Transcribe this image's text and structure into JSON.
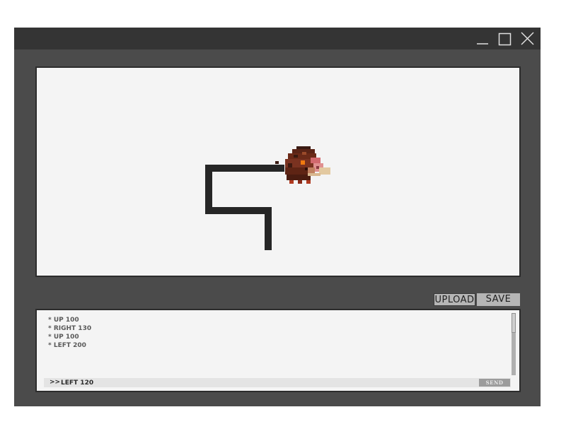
{
  "window": {
    "buttons": [
      {
        "name": "minimize",
        "icon": "minimize-icon"
      },
      {
        "name": "maximize",
        "icon": "maximize-icon"
      },
      {
        "name": "close",
        "icon": "close-icon"
      }
    ]
  },
  "canvas": {
    "sprite": "boar-pixel-sprite-icon"
  },
  "toolbar": {
    "upload_label": "UPLOAD",
    "save_label": "SAVE"
  },
  "console": {
    "history": [
      "* UP 100",
      "* RIGHT 130",
      "* UP 100",
      "* LEFT 200"
    ],
    "prompt_prefix": ">>",
    "input_value": "LEFT 120",
    "send_label": "SEND"
  },
  "colors": {
    "titlebar": "#343434",
    "window": "#4b4b4b",
    "canvas": "#f4f4f4",
    "path": "#262626",
    "button": "#b5b5b5"
  }
}
